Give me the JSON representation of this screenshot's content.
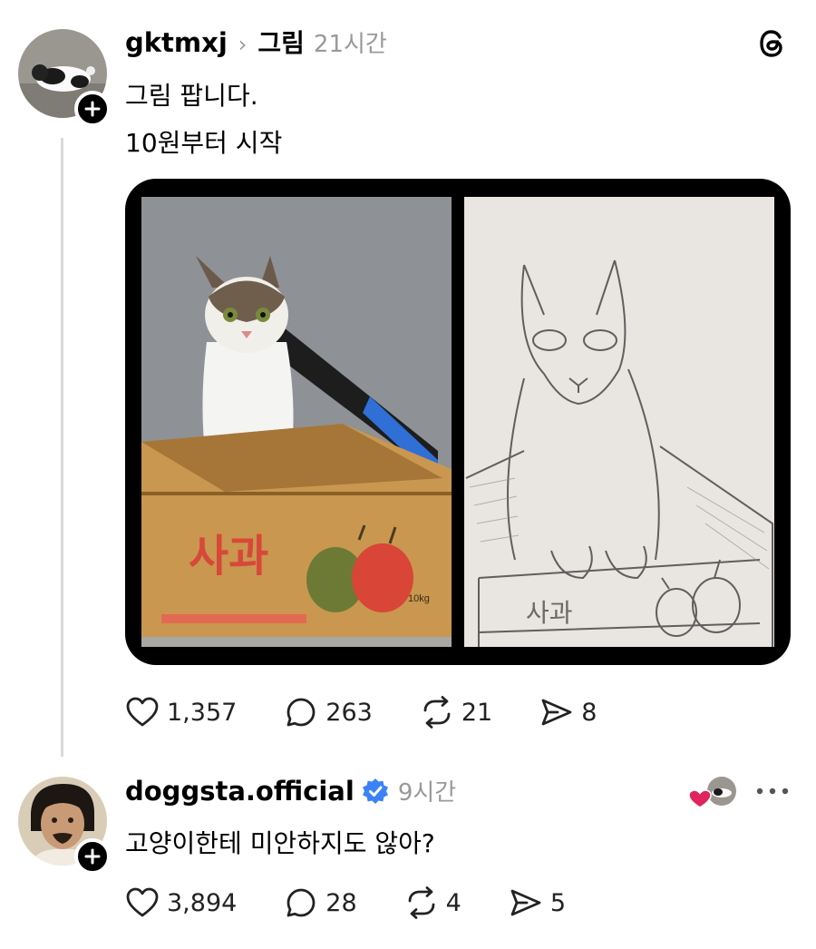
{
  "post": {
    "username": "gktmxj",
    "topic": "그림",
    "time": "21시간",
    "line1": "그림 팝니다.",
    "line2": "10원부터 시작",
    "box_label_photo": "사과",
    "box_label_drawing": "사과",
    "box_weight": "10kg",
    "stats": {
      "likes": "1,357",
      "replies": "263",
      "reposts": "21",
      "shares": "8"
    }
  },
  "reply": {
    "username": "doggsta.official",
    "verified": true,
    "time": "9시간",
    "text": "고양이한테 미안하지도 않아?",
    "stats": {
      "likes": "3,894",
      "replies": "28",
      "reposts": "4",
      "shares": "5"
    }
  },
  "colors": {
    "verified": "#3b82f6",
    "heart_red": "#e0245e",
    "muted": "#999999",
    "thread_line": "#d9d9d9"
  },
  "icons": [
    "threads-logo-icon",
    "plus-icon",
    "heart-icon",
    "comment-icon",
    "repost-icon",
    "share-icon",
    "verified-badge-icon",
    "more-icon"
  ]
}
